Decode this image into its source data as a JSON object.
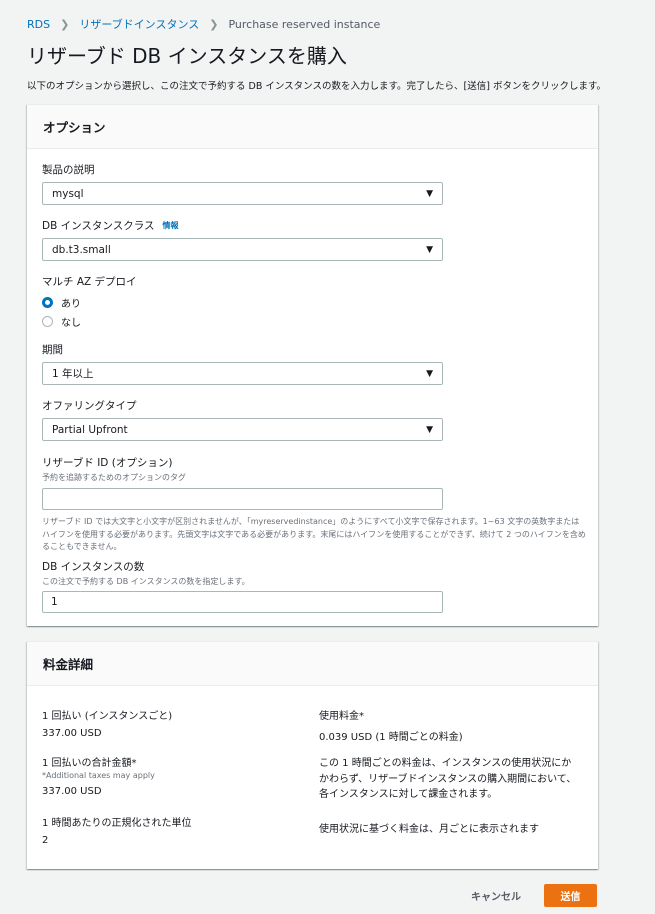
{
  "breadcrumb": {
    "items": [
      "RDS",
      "リザーブドインスタンス"
    ],
    "current": "Purchase reserved instance"
  },
  "page": {
    "title": "リザーブド DB インスタンスを購入",
    "description": "以下のオプションから選択し、この注文で予約する DB インスタンスの数を入力します。完了したら、[送信] ボタンをクリックします。"
  },
  "options": {
    "header": "オプション",
    "product": {
      "label": "製品の説明",
      "value": "mysql"
    },
    "instance_class": {
      "label": "DB インスタンスクラス",
      "info": "情報",
      "value": "db.t3.small"
    },
    "multi_az": {
      "label": "マルチ AZ デプロイ",
      "yes": "あり",
      "no": "なし",
      "selected": "yes"
    },
    "term": {
      "label": "期間",
      "value": "1 年以上"
    },
    "offering": {
      "label": "オファリングタイプ",
      "value": "Partial Upfront"
    },
    "reserved_id": {
      "label": "リザーブド ID (オプション)",
      "hint": "予約を追跡するためのオプションのタグ",
      "value": "",
      "constraint": "リザーブド ID では大文字と小文字が区別されませんが、「myreservedinstance」のようにすべて小文字で保存されます。1~63 文字の英数字またはハイフンを使用する必要があります。先頭文字は文字である必要があります。末尾にはハイフンを使用することができず、続けて 2 つのハイフンを含めることもできません。"
    },
    "count": {
      "label": "DB インスタンスの数",
      "hint": "この注文で予約する DB インスタンスの数を指定します。",
      "value": "1"
    }
  },
  "pricing": {
    "header": "料金詳細",
    "one_time": {
      "label": "1 回払い (インスタンスごと)",
      "value": "337.00 USD"
    },
    "one_time_total": {
      "label": "1 回払いの合計金額*",
      "sub": "*Additional taxes may apply",
      "value": "337.00 USD"
    },
    "normalized_units": {
      "label": "1 時間あたりの正規化された単位",
      "value": "2"
    },
    "usage": {
      "label": "使用料金*",
      "value": "0.039 USD (1 時間ごとの料金)"
    },
    "usage_note": "この 1 時間ごとの料金は、インスタンスの使用状況にかかわらず、リザーブドインスタンスの購入期間において、各インスタンスに対して課金されます。",
    "usage_display": "使用状況に基づく料金は、月ごとに表示されます"
  },
  "actions": {
    "cancel": "キャンセル",
    "submit": "送信"
  },
  "colors": {
    "accent": "#ec7211",
    "link": "#0073bb",
    "background": "#f2f3f3"
  }
}
